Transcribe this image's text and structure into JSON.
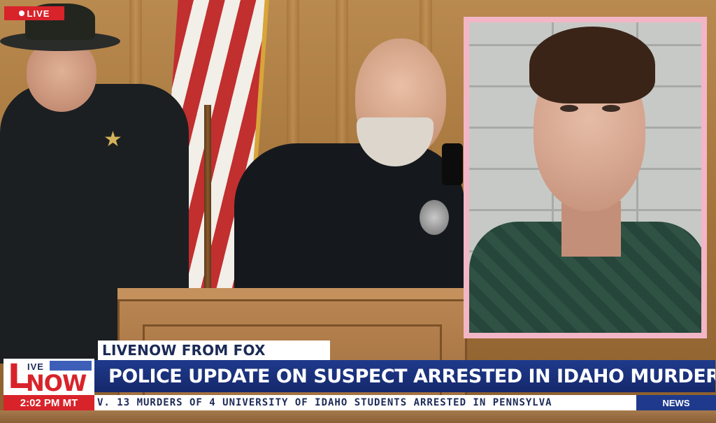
{
  "live_tag": {
    "label": "LIVE"
  },
  "lower_third": {
    "subtitle": "LIVENOW FROM FOX",
    "headline": "POLICE UPDATE ON SUSPECT ARRESTED IN IDAHO MURDERS",
    "ticker": "V. 13 MURDERS OF 4 UNIVERSITY OF IDAHO STUDENTS ARRESTED IN PENNSYLVA",
    "time": "2:02 PM MT",
    "news_tag": "NEWS"
  },
  "logo": {
    "letter": "L",
    "ive": "IVE",
    "now": "NOW"
  },
  "colors": {
    "fox_red": "#d8232a",
    "fox_blue": "#1f3a8c",
    "inset_border": "#f3b6c6"
  }
}
